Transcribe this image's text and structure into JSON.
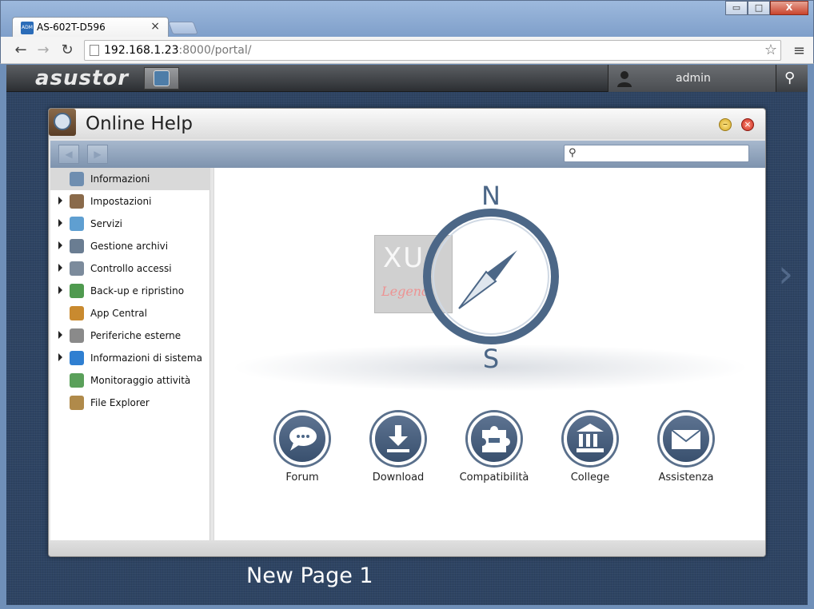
{
  "browser": {
    "tab_title": "AS-602T-D596",
    "tab_close": "×",
    "favicon_text": "ADM",
    "url_host": "192.168.1.23",
    "url_rest": ":8000/portal/",
    "back_icon": "←",
    "forward_icon": "→",
    "reload_icon": "↻",
    "star_icon": "☆",
    "menu_icon": "≡",
    "win_minimize": "▭",
    "win_maximize": "□",
    "win_close": "X"
  },
  "asustor": {
    "logo": "asustor",
    "user": "admin",
    "search_icon": "⚲"
  },
  "help_window": {
    "title": "Online Help",
    "min_label": "–",
    "close_label": "×",
    "nav_back": "◀",
    "nav_forward": "▶",
    "search_placeholder": "",
    "search_icon": "⚲"
  },
  "sidebar": {
    "items": [
      {
        "label": "Informazioni",
        "expandable": false,
        "active": true,
        "icon": "compass-icon",
        "color": "#6f8eb0"
      },
      {
        "label": "Impostazioni",
        "expandable": true,
        "active": false,
        "icon": "settings-icon",
        "color": "#8a6a4a"
      },
      {
        "label": "Servizi",
        "expandable": true,
        "active": false,
        "icon": "services-icon",
        "color": "#5f9fd1"
      },
      {
        "label": "Gestione archivi",
        "expandable": true,
        "active": false,
        "icon": "storage-icon",
        "color": "#6a7d92"
      },
      {
        "label": "Controllo accessi",
        "expandable": true,
        "active": false,
        "icon": "access-icon",
        "color": "#7c8b9c"
      },
      {
        "label": "Back-up e ripristino",
        "expandable": true,
        "active": false,
        "icon": "backup-icon",
        "color": "#4f9a4f"
      },
      {
        "label": "App Central",
        "expandable": false,
        "active": false,
        "icon": "app-central-icon",
        "color": "#c98a2f"
      },
      {
        "label": "Periferiche esterne",
        "expandable": true,
        "active": false,
        "icon": "external-devices-icon",
        "color": "#8a8a8a"
      },
      {
        "label": "Informazioni di sistema",
        "expandable": true,
        "active": false,
        "icon": "system-info-icon",
        "color": "#2f7fd1"
      },
      {
        "label": "Monitoraggio attività",
        "expandable": false,
        "active": false,
        "icon": "activity-monitor-icon",
        "color": "#5aa05a"
      },
      {
        "label": "File Explorer",
        "expandable": false,
        "active": false,
        "icon": "file-explorer-icon",
        "color": "#b08a4a"
      }
    ]
  },
  "compass": {
    "north": "N",
    "south": "S"
  },
  "watermark": {
    "line1": "XU",
    "line2": "Legend"
  },
  "support": [
    {
      "label": "Forum",
      "icon": "forum-icon"
    },
    {
      "label": "Download",
      "icon": "download-icon"
    },
    {
      "label": "Compatibilità",
      "icon": "compatibility-icon"
    },
    {
      "label": "College",
      "icon": "college-icon"
    },
    {
      "label": "Assistenza",
      "icon": "support-mail-icon"
    }
  ],
  "desktop": {
    "page_label": "New Page 1",
    "next_arrow": "›"
  },
  "colors": {
    "desktop_bg": "#2e4463",
    "accent": "#4c6787"
  }
}
